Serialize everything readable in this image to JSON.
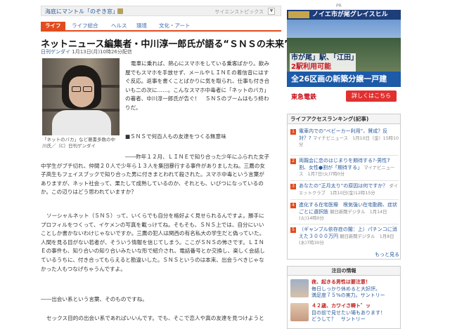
{
  "topbar": {
    "title": "海底にマントル「のぞき窓」",
    "section": "サイエンストピックス",
    "dropdown": "▼"
  },
  "tabs": [
    {
      "label": "ライフ",
      "active": true
    },
    {
      "label": "ライフ総合"
    },
    {
      "label": "ヘルス"
    },
    {
      "label": "環境"
    },
    {
      "label": "文化・アート"
    }
  ],
  "article": {
    "headline": "ネットニュース編集者・中川淳一郎氏が語る“ＳＮＳの未来”",
    "source": "日刊ゲンダイ",
    "datetime": "1月13日(月)10時26分配信",
    "caption_lines": [
      "「ネットのバカ」など著書多数の中",
      "川氏／（C）日刊ゲンダイ"
    ],
    "p1": [
      "電車に乗れば、熱心にスマホをしている乗客ばかり。飲み",
      "屋でもスマホを手放せず、メールやＬＩＮＥの着信音にはす",
      "ぐ反応。返事を書くことばかりに気を取られ、仕事も付き合",
      "いも二の次に……。こんなスマホ中毒者に「ネットのバカ」",
      "の著者、中川淳一郎氏が告ぐ！　ＳＮＳのブームはもう終わ",
      "りだ。"
    ],
    "subhead": "■ＳＮＳで何百人もの友達をつくる無意味",
    "p2": [
      "――昨年１２月、ＬＩＮＥで知り合った少年にふられた女子",
      "中学生がブチ切れ、仲間２０人で少年ら１３人を集団暴行する事件がありましたね。三鷹の女",
      "子高生もフェイスブックで知り合った男に付きまとわれて殺された。スマホ中毒という言葉が",
      "ありますが、ネット社会って、果たして成熟しているのか、それとも、いびつになっているの",
      "か。この辺りはどう思われていますか？"
    ],
    "p3": [
      "ソーシャルネット（ＳＮＳ）って、いくらでも自分を格好よく見せられるんですよ。勝手に",
      "プロフィルをつくって、イケメンの写真を載っけてね。そもそも、ＳＮＳ上では、自分にいい",
      "ことしか書かないわけじゃないですか。三鷹の犯人は関西の有名私大の学生だと偽っていた。",
      "人間を見る目がない若者が、そういう情報を信じてしまう。ここがＳＮＳの怖さです。ＬＩＮ",
      "Ｅの事件も、知り合いの知り合いみたいな形で紹介され、電話番号とか交換し、楽しく会話し",
      "ているうちに、付き合ってもらえると勘違いした。ＳＮＳというのは本来、出会うべきじゃな",
      "かった人もつなげちゃうんですよ。"
    ],
    "p4": "――出会い系という言葉、そのものですね。",
    "p5": "セックス目的の出会い系であればいいんです。でも、そこで恋人や真の友達を見つけようと"
  },
  "sidebar": {
    "pr": "PR",
    "ad": {
      "header": "ノイエ市が尾グレイスヒル",
      "tag_line1": "市が尾」駅、「江田」駅、",
      "tag_line2": "2駅利用可能",
      "band": "全26区画の新築分譲一戸建",
      "brand": "東急電鉄",
      "button": "詳しくはこちら"
    },
    "ranking": {
      "header": "ライフアクセスランキング(記事)",
      "items": [
        {
          "num": "1",
          "title": "電車内での“ベビーカー利用”、賛成？反対？?",
          "meta": "マイナビニュース　1月10日（金）15時10分"
        },
        {
          "num": "2",
          "title": "両親会に恋のはじまりを期待する?-男性7割、女性●割が「期待する」",
          "meta": "マイナビニュース　1月7日(火)7時0分"
        },
        {
          "num": "3",
          "title": "あなたの“正月太り”の原因は何ですか？",
          "meta": "ダイエットクラブ　1月10日(金)12時15分"
        },
        {
          "num": "4",
          "title": "進化する在宅医療　根気強い在宅勤務、症状ごとに選択肢",
          "meta": "朝日新聞デジタル　1月14日(火)14時0分"
        },
        {
          "num": "5",
          "title": "（ギャンブル依存症の闇：上）パチンコに消えた３０００万円",
          "meta": "朝日新聞デジタル　1月8日(水)7時30分"
        }
      ],
      "more": "もっと見る"
    },
    "promo": {
      "header": "注目の情報",
      "items": [
        {
          "head": "夜、起きる男性は要注意！",
          "body1": "毎日しっかり休めると大好評。",
          "body2": "満足度７５%の実力。サントリー"
        },
        {
          "head": "４２歳、カワイさ瞬ト゛ッ",
          "body1": "目の前で見せたい場もあります！",
          "body2": "どうして？　サントリー"
        }
      ]
    }
  }
}
